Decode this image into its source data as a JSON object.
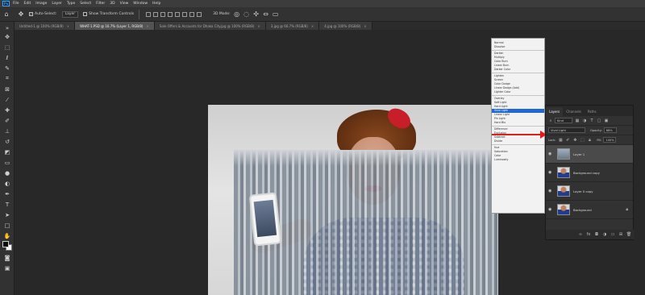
{
  "menubar": {
    "logo": "Ps",
    "items": [
      "File",
      "Edit",
      "Image",
      "Layer",
      "Type",
      "Select",
      "Filter",
      "3D",
      "View",
      "Window",
      "Help"
    ]
  },
  "options": {
    "auto_select_label": "Auto-Select:",
    "auto_select_value": "Layer",
    "show_transform_label": "Show Transform Controls",
    "mode_3d_label": "3D Mode:"
  },
  "tabs": [
    {
      "label": "Untitled-1 @ 100% (RGB/8)"
    },
    {
      "label": "WHAT-1.PSD @ 16.7% (Layer 1, RGB/8)"
    },
    {
      "label": "Sale Offers & Accounts for Dhaka City.jpg @ 100% (RGB/8)"
    },
    {
      "label": "3.jpg @ 66.7% (RGB/8)"
    },
    {
      "label": "4.jpg @ 100% (RGB/8)"
    }
  ],
  "blend_modes": [
    [
      "Normal",
      "Dissolve"
    ],
    [
      "Darken",
      "Multiply",
      "Color Burn",
      "Linear Burn",
      "Darker Color"
    ],
    [
      "Lighten",
      "Screen",
      "Color Dodge",
      "Linear Dodge (Add)",
      "Lighter Color"
    ],
    [
      "Overlay",
      "Soft Light",
      "Hard Light",
      "Vivid Light",
      "Linear Light",
      "Pin Light",
      "Hard Mix"
    ],
    [
      "Difference",
      "Exclusion",
      "Subtract",
      "Divide"
    ],
    [
      "Hue",
      "Saturation",
      "Color",
      "Luminosity"
    ]
  ],
  "selected_blend_mode": "Vivid Light",
  "layers_panel": {
    "tabs": [
      "Layers",
      "Channels",
      "Paths"
    ],
    "kind_filter": "Kind",
    "blend_value": "Vivid Light",
    "opacity_label": "Opacity:",
    "opacity_value": "68%",
    "lock_label": "Lock:",
    "fill_label": "Fill:",
    "fill_value": "100%",
    "layers": [
      {
        "name": "Layer 1",
        "thumb": "city",
        "active": true,
        "locked": false
      },
      {
        "name": "Background copy",
        "thumb": "woman",
        "active": false,
        "locked": false
      },
      {
        "name": "Layer 0 copy",
        "thumb": "woman",
        "active": false,
        "locked": false
      },
      {
        "name": "Background",
        "thumb": "woman",
        "active": false,
        "locked": true
      }
    ]
  },
  "colors": {
    "app_bg": "#282828",
    "panel": "#323232",
    "highlight": "#1f68d6",
    "annotation_red": "#e21b1b"
  }
}
